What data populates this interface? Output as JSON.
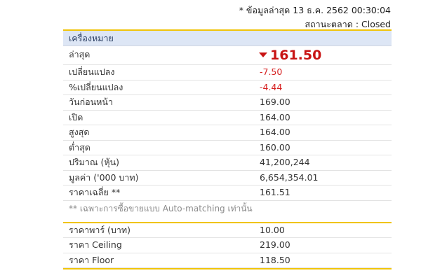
{
  "meta": {
    "data_time": "* ข้อมูลล่าสุด 13 ธ.ค. 2562 00:30:04",
    "market_status": "สถานะตลาด : Closed"
  },
  "quote": {
    "header": "เครื่องหมาย",
    "last_label": "ล่าสุด",
    "last_value": "161.50",
    "direction": "down",
    "rows": [
      {
        "label": "เปลี่ยนแปลง",
        "value": "-7.50",
        "negative": true
      },
      {
        "label": "%เปลี่ยนแปลง",
        "value": "-4.44",
        "negative": true
      },
      {
        "label": "วันก่อนหน้า",
        "value": "169.00"
      },
      {
        "label": "เปิด",
        "value": "164.00"
      },
      {
        "label": "สูงสุด",
        "value": "164.00"
      },
      {
        "label": "ต่ำสุด",
        "value": "160.00"
      },
      {
        "label": "ปริมาณ (หุ้น)",
        "value": "41,200,244"
      },
      {
        "label": "มูลค่า ('000 บาท)",
        "value": "6,654,354.01"
      },
      {
        "label": "ราคาเฉลี่ย **",
        "value": "161.51"
      }
    ],
    "note": "** เฉพาะการซื้อขายแบบ Auto-matching เท่านั้น"
  },
  "price_info": {
    "rows": [
      {
        "label": "ราคาพาร์ (บาท)",
        "value": "10.00"
      },
      {
        "label": "ราคา Ceiling",
        "value": "219.00"
      },
      {
        "label": "ราคา Floor",
        "value": "118.50"
      }
    ]
  },
  "colors": {
    "accent": "#f0c40a",
    "header_bg": "#dde6f5",
    "negative": "#d61f1f"
  }
}
